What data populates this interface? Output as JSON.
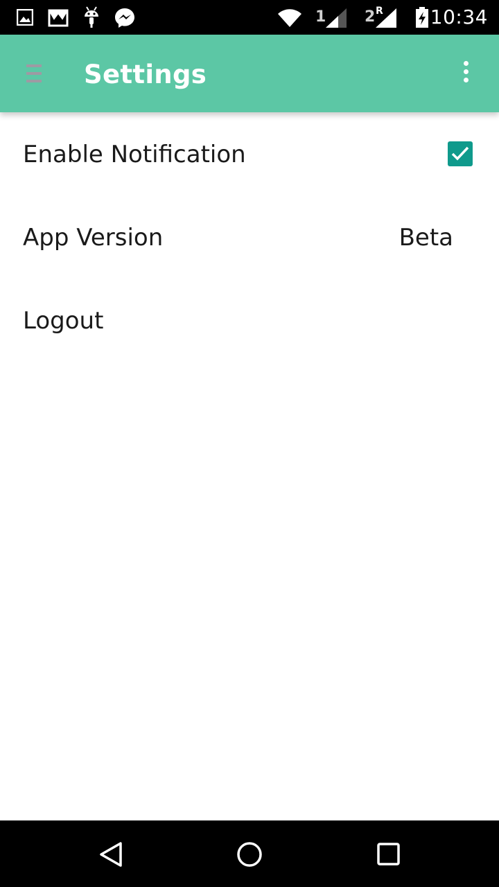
{
  "status_bar": {
    "time": "10:34",
    "sim1_label": "1",
    "sim2_label": "2",
    "sim2_roaming": "R",
    "icons": [
      "gallery-icon",
      "shopping-bag-icon",
      "android-debug-icon",
      "messenger-icon",
      "wifi-icon",
      "signal-sim1-icon",
      "signal-sim2-icon",
      "battery-charging-icon"
    ]
  },
  "app_bar": {
    "title": "Settings",
    "background_color": "#5cc7a5",
    "menu_icon": "menu-icon",
    "overflow_icon": "more-vert-icon"
  },
  "settings": {
    "notification": {
      "label": "Enable Notification",
      "checked": true,
      "checkbox_color": "#0f9a8c"
    },
    "version": {
      "label": "App Version",
      "value": "Beta"
    },
    "logout": {
      "label": "Logout"
    }
  },
  "nav_bar": {
    "buttons": [
      "back-icon",
      "home-icon",
      "recents-icon"
    ]
  }
}
